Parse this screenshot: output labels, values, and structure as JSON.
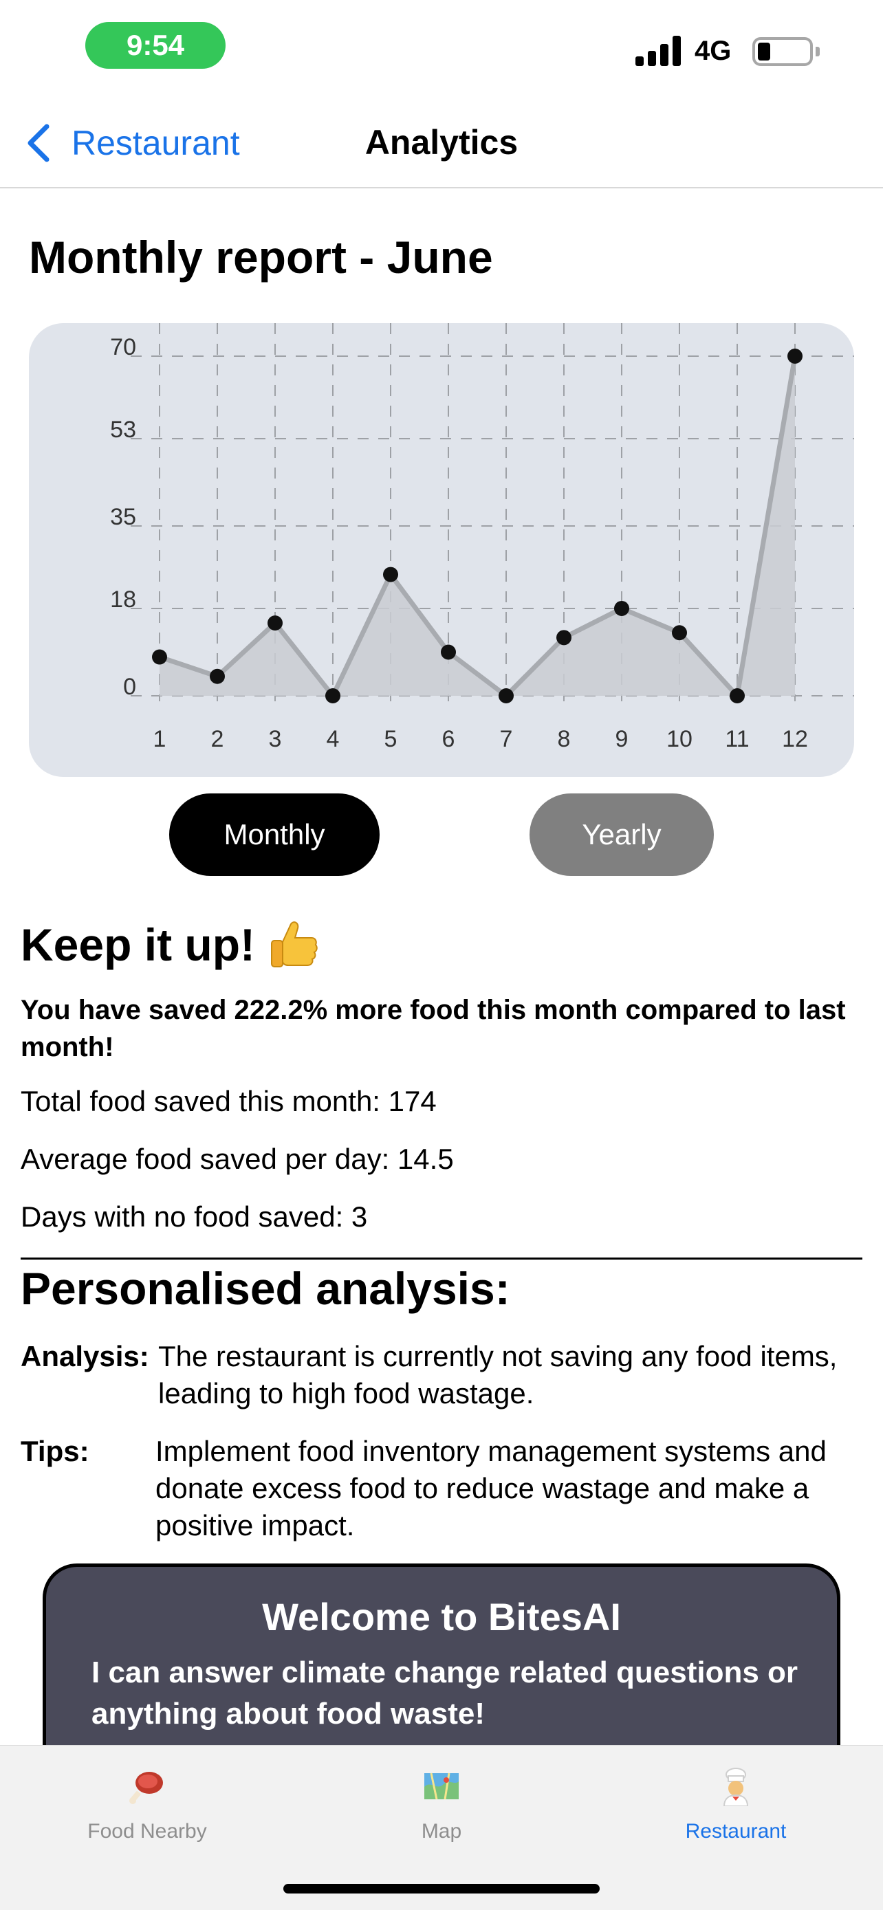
{
  "status_bar": {
    "time": "9:54",
    "network": "4G"
  },
  "nav": {
    "back_label": "Restaurant",
    "title": "Analytics"
  },
  "report": {
    "title": "Monthly report - June"
  },
  "chart_data": {
    "type": "line",
    "x": [
      1,
      2,
      3,
      4,
      5,
      6,
      7,
      8,
      9,
      10,
      11,
      12
    ],
    "values": [
      8,
      4,
      15,
      0,
      25,
      9,
      0,
      12,
      18,
      13,
      0,
      70
    ],
    "yticks": [
      0,
      18,
      35,
      53,
      70
    ],
    "ylim": [
      0,
      70
    ],
    "grid": true,
    "fill": "area",
    "colors": {
      "line": "#a8abb0",
      "area": "#c9ccd2",
      "points": "#111111",
      "grid": "#9ea1a6"
    }
  },
  "toggle": {
    "monthly_label": "Monthly",
    "yearly_label": "Yearly",
    "selected": "Monthly"
  },
  "summary": {
    "heading": "Keep it up!",
    "heading_icon": "thumbs-up-icon",
    "saved_line": "You have saved 222.2% more food this month compared to last month!",
    "total": "Total food saved this month: 174",
    "average": "Average food saved per day: 14.5",
    "days_none": "Days with no food saved: 3"
  },
  "analysis": {
    "title": "Personalised analysis:",
    "analysis_label": "Analysis:",
    "analysis_text": "The restaurant is currently not saving any food items, leading to high food wastage.",
    "tips_label": "Tips:",
    "tips_text": "Implement food inventory management systems and donate excess food to reduce wastage and make a positive impact."
  },
  "chat": {
    "title": "Welcome to BitesAI",
    "text": "I can answer climate change related questions or anything about food waste!"
  },
  "tabs": [
    {
      "label": "Food Nearby",
      "icon": "meat-icon",
      "active": false
    },
    {
      "label": "Map",
      "icon": "map-icon",
      "active": false
    },
    {
      "label": "Restaurant",
      "icon": "chef-icon",
      "active": true
    }
  ],
  "colors": {
    "accent": "#1a73e8",
    "time_pill": "#34c759",
    "chat_bg": "#4a4a5a"
  }
}
